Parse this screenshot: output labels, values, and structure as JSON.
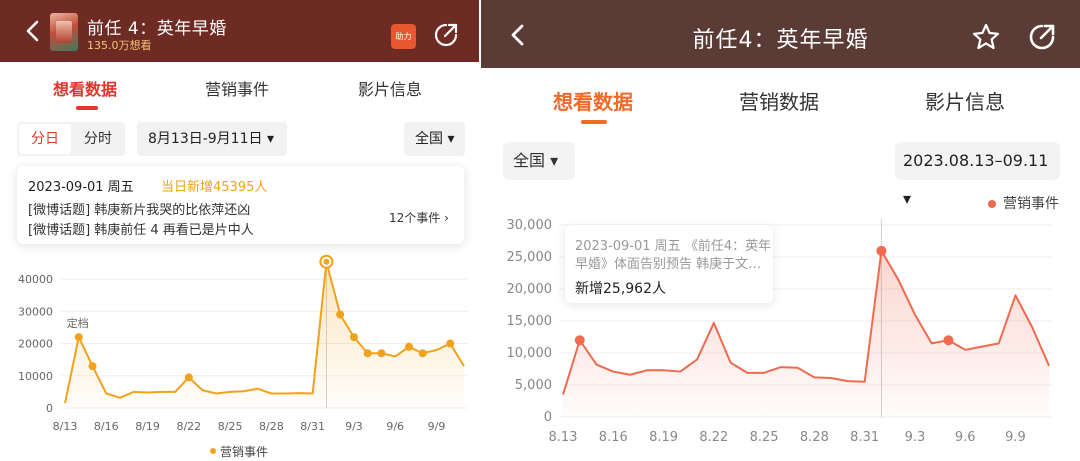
{
  "left": {
    "header": {
      "title": "前任 4：英年早婚",
      "subtitle": "135.0万想看",
      "help_label": "助力",
      "back_icon": "chevron-left-icon",
      "share_icon": "share-icon"
    },
    "tabs": [
      {
        "label": "想看数据",
        "active": true
      },
      {
        "label": "营销事件",
        "active": false
      },
      {
        "label": "影片信息",
        "active": false
      }
    ],
    "filters": {
      "seg_day": "分日",
      "seg_hour": "分时",
      "date_range": "8月13日-9月11日 ▾",
      "region": "全国 ▾"
    },
    "tooltip": {
      "date": "2023-09-01  周五",
      "new_add": "当日新增45395人",
      "event1": "[微博话题] 韩庚新片我哭的比依萍还凶",
      "event2": "[微博话题] 韩庚前任 4 再看已是片中人",
      "event_count": "12个事件 ›"
    },
    "legend": "营销事件",
    "annotation": "定档"
  },
  "right": {
    "header": {
      "title": "前任4：英年早婚",
      "back_icon": "chevron-left-icon",
      "star_icon": "star-icon",
      "share_icon": "share-icon"
    },
    "tabs": [
      {
        "label": "想看数据",
        "active": true
      },
      {
        "label": "营销数据",
        "active": false
      },
      {
        "label": "影片信息",
        "active": false
      }
    ],
    "filters": {
      "region": "全国 ▾",
      "date_range": "2023.08.13–09.11 ▾"
    },
    "legend": "营销事件",
    "tooltip": {
      "line1": "2023-09-01 周五 《前任4：英年",
      "line2": "早婚》体面告别预告 韩庚于文…",
      "line3": "新增25,962人"
    }
  },
  "colors": {
    "left_line": "#f2a21a",
    "right_line": "#f06a50",
    "left_header_bg": "#6e2b23",
    "right_header_bg": "#5a3b35",
    "active_tab_left": "#e2352c",
    "active_tab_right": "#f06a2a"
  },
  "chart_data": [
    {
      "type": "line",
      "x": [
        "8/13",
        "8/14",
        "8/15",
        "8/16",
        "8/17",
        "8/18",
        "8/19",
        "8/20",
        "8/21",
        "8/22",
        "8/23",
        "8/24",
        "8/25",
        "8/26",
        "8/27",
        "8/28",
        "8/29",
        "8/30",
        "8/31",
        "9/1",
        "9/2",
        "9/3",
        "9/4",
        "9/5",
        "9/6",
        "9/7",
        "9/8",
        "9/9",
        "9/10",
        "9/11"
      ],
      "x_ticks": [
        "8/13",
        "8/16",
        "8/19",
        "8/22",
        "8/25",
        "8/28",
        "8/31",
        "9/3",
        "9/6",
        "9/9"
      ],
      "y_ticks": [
        "0",
        "10000",
        "20000",
        "30000",
        "40000"
      ],
      "series": [
        {
          "name": "营销事件",
          "values": [
            1500,
            22000,
            13000,
            4500,
            3200,
            5000,
            4800,
            5000,
            5000,
            9500,
            5500,
            4500,
            5000,
            5200,
            6000,
            4500,
            4500,
            4600,
            4500,
            45395,
            29000,
            22000,
            17000,
            17000,
            16000,
            19000,
            17000,
            18000,
            20000,
            13000
          ]
        }
      ],
      "ylim": [
        0,
        45000
      ],
      "markers_at": [
        "8/14",
        "8/15",
        "8/22",
        "9/1",
        "9/2",
        "9/3",
        "9/4",
        "9/5",
        "9/7",
        "9/8",
        "9/10"
      ],
      "legend_position": "bottom",
      "grid": true
    },
    {
      "type": "line",
      "x": [
        "8.13",
        "8.14",
        "8.15",
        "8.16",
        "8.17",
        "8.18",
        "8.19",
        "8.20",
        "8.21",
        "8.22",
        "8.23",
        "8.24",
        "8.25",
        "8.26",
        "8.27",
        "8.28",
        "8.29",
        "8.30",
        "8.31",
        "9.1",
        "9.2",
        "9.3",
        "9.4",
        "9.5",
        "9.6",
        "9.7",
        "9.8",
        "9.9",
        "9.10",
        "9.11"
      ],
      "x_ticks": [
        "8.13",
        "8.16",
        "8.19",
        "8.22",
        "8.25",
        "8.28",
        "8.31",
        "9.3",
        "9.6",
        "9.9"
      ],
      "y_ticks": [
        "0",
        "5,000",
        "10,000",
        "15,000",
        "20,000",
        "25,000",
        "30,000"
      ],
      "series": [
        {
          "name": "营销事件",
          "values": [
            3500,
            12000,
            8200,
            7100,
            6600,
            7300,
            7300,
            7100,
            9000,
            14700,
            8500,
            6900,
            6900,
            7800,
            7700,
            6200,
            6100,
            5600,
            5500,
            25962,
            21500,
            16000,
            11500,
            12000,
            10500,
            11000,
            11500,
            19000,
            14000,
            8000
          ]
        }
      ],
      "ylim": [
        0,
        30000
      ],
      "markers_at": [
        "8.14",
        "9.1",
        "9.5"
      ],
      "legend_position": "top-right",
      "grid": true
    }
  ]
}
